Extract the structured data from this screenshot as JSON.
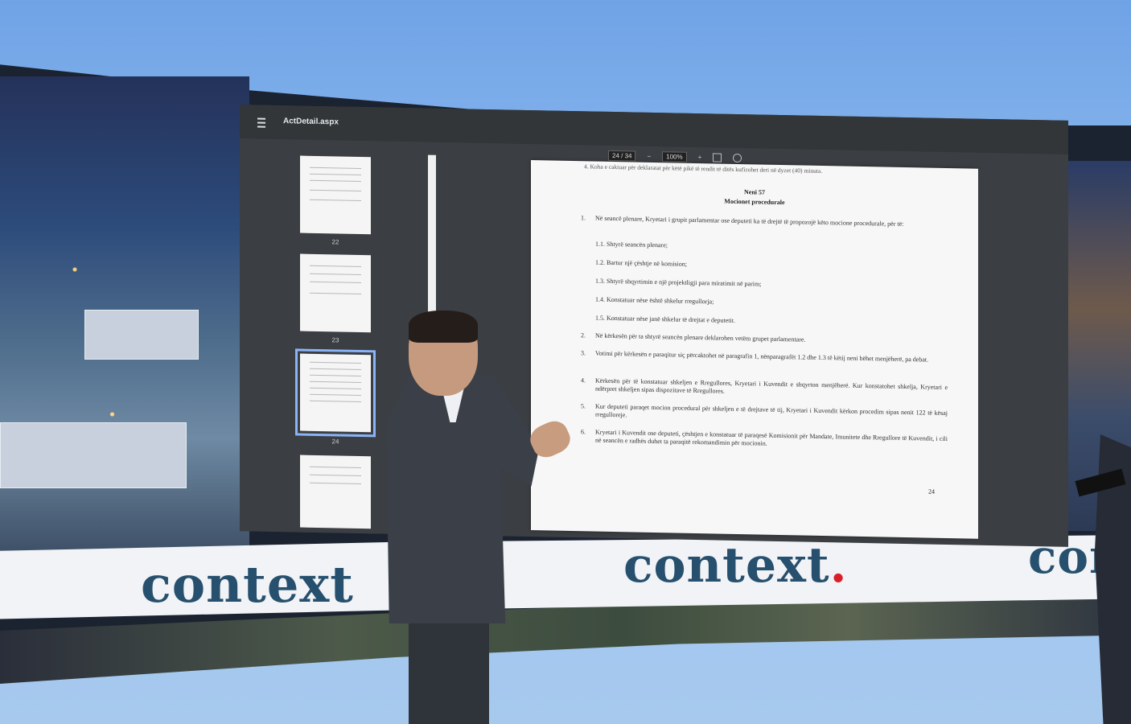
{
  "viewer": {
    "file_name": "ActDetail.aspx",
    "page_counter": "24 / 34",
    "zoom": "100%",
    "thumbnails": [
      {
        "number": "22"
      },
      {
        "number": "23"
      },
      {
        "number": "24",
        "selected": true
      },
      {
        "number": ""
      }
    ]
  },
  "document": {
    "top_line": "4.   Koha e caktuar për deklaratat për këtë pikë të rendit të ditës kufizohet deri në dyzet (40) minuta.",
    "article_title": "Neni 57",
    "article_subtitle": "Mocionet procedurale",
    "items": [
      {
        "n": "1.",
        "text": "Në seancë plenare, Kryetari i grupit parlamentar ose deputeti ka të drejtë të propozojë këto mocione procedurale, për të:"
      },
      {
        "n": "2.",
        "text": "Në kërkesën për ta shtyrë seancën plenare deklarohen vetëm grupet parlamentare."
      },
      {
        "n": "3.",
        "text": "Votimi për kërkesën e paraqitur siç përcaktohet në paragrafin 1, nënparagrafët 1.2 dhe 1.3 të këtij neni bëhet menjëherë, pa debat."
      },
      {
        "n": "4.",
        "text": "Kërkesën për të konstatuar shkeljen e Rregullores, Kryetari i Kuvendit e shqyrton menjëherë. Kur konstatohet shkelja, Kryetari e ndërpret shkeljen sipas dispozitave të Rregullores."
      },
      {
        "n": "5.",
        "text": "Kur deputeti paraqet mocion procedural për shkeljen e të drejtave të tij, Kryetari i Kuvendit kërkon procedim sipas nenit 122 të kësaj rregulloreje."
      },
      {
        "n": "6.",
        "text": "Kryetari i Kuvendit ose deputeti, çështjen e konstatuar të paraqesë Komisionit për Mandate, Imunitete dhe Rregullore të Kuvendit, i cili në seancën e radhës duhet ta paraqitë rekomandimin për mocionin."
      }
    ],
    "subitems": [
      "1.1. Shtyrë seancën plenare;",
      "1.2. Bartur një çështje në komision;",
      "1.3. Shtyrë shqyrtimin e një projektligji para miratimit në parim;",
      "1.4. Konstatuar nëse është shkelur rregullorja;",
      "1.5. Konstatuar nëse janë shkelur të drejtat e deputetit."
    ],
    "page_number": "24"
  },
  "branding": {
    "word": "context",
    "dot": "."
  },
  "colors": {
    "brand_text": "#27506e",
    "brand_dot": "#d9202a",
    "sky": "#8fbbef",
    "viewer_bg": "#3b3e42"
  }
}
